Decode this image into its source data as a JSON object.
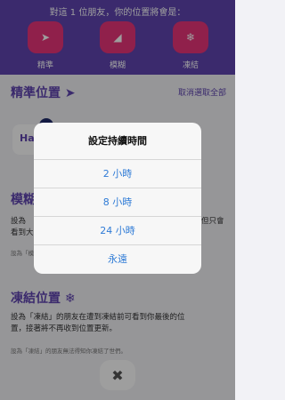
{
  "header": {
    "caption": "對這 1 位朋友，你的位置將會是：",
    "options": [
      {
        "icon": "navigation-arrow-icon",
        "glyph": "➤",
        "label": "精準"
      },
      {
        "icon": "fuzzy-location-icon",
        "glyph": "◢",
        "label": "模糊"
      },
      {
        "icon": "snowflake-icon",
        "glyph": "❄",
        "label": "凍結"
      }
    ]
  },
  "precise_section": {
    "title": "精準位置 ➤",
    "deselect_all": "取消選取全部",
    "friend_initials": "Ha"
  },
  "fuzzy_section": {
    "title": "模糊",
    "desc_line1": "設為",
    "desc_line2": "看到大",
    "desc_right": "但只會",
    "note_prefix": "設為「模"
  },
  "frozen_section": {
    "title": "凍結位置 ❄",
    "desc_line1": "設為「凍結」的朋友在遭到凍結前可看到你最後的位",
    "desc_line2": "置，接著將不再收到位置更新。",
    "note": "設為「凍結」的朋友無法得知你凍結了世們。"
  },
  "close_button": {
    "glyph": "✖"
  },
  "modal": {
    "title": "設定持續時間",
    "options": [
      "2 小時",
      "8 小時",
      "24 小時",
      "永遠"
    ]
  },
  "colors": {
    "header_bg": "#5f44b0",
    "tile_bg": "#e8347a",
    "accent": "#5f44b0",
    "option_text": "#2f7bd6"
  }
}
